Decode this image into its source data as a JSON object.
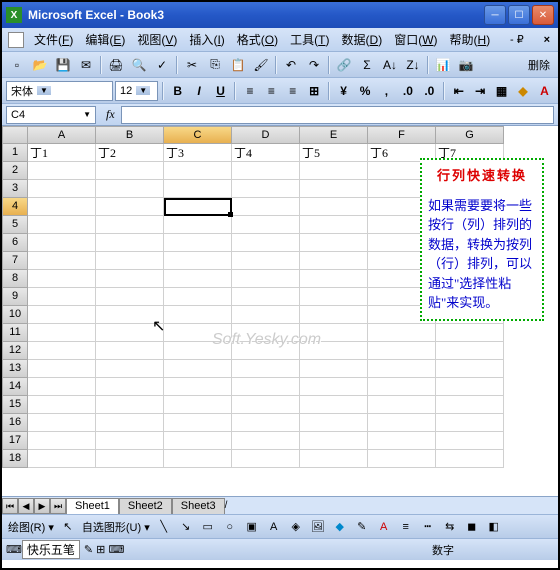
{
  "window": {
    "title": "Microsoft Excel - Book3",
    "app_icon": "X"
  },
  "menu": {
    "items": [
      {
        "label": "文件",
        "key": "F"
      },
      {
        "label": "编辑",
        "key": "E"
      },
      {
        "label": "视图",
        "key": "V"
      },
      {
        "label": "插入",
        "key": "I"
      },
      {
        "label": "格式",
        "key": "O"
      },
      {
        "label": "工具",
        "key": "T"
      },
      {
        "label": "数据",
        "key": "D"
      },
      {
        "label": "窗口",
        "key": "W"
      },
      {
        "label": "帮助",
        "key": "H"
      }
    ]
  },
  "toolbar": {
    "delete_label": "删除"
  },
  "format": {
    "font": "宋体",
    "size": "12"
  },
  "namebox": {
    "value": "C4"
  },
  "columns": [
    "A",
    "B",
    "C",
    "D",
    "E",
    "F",
    "G"
  ],
  "row_numbers": [
    1,
    2,
    3,
    4,
    5,
    6,
    7,
    8,
    9,
    10,
    11,
    12,
    13,
    14,
    15,
    16,
    17,
    18
  ],
  "cells": {
    "row1": [
      "丁1",
      "丁2",
      "丁3",
      "丁4",
      "丁5",
      "丁6",
      "丁7"
    ]
  },
  "selected": {
    "col": "C",
    "row": 4
  },
  "tooltip": {
    "title": "行列快速转换",
    "body": "如果需要要将一些按行（列）排列的数据，转换为按列（行）排列，可以通过\"选择性粘贴\"来实现。"
  },
  "watermark": "Soft.Yesky.com",
  "sheets": {
    "tabs": [
      "Sheet1",
      "Sheet2",
      "Sheet3"
    ],
    "active": 0
  },
  "drawbar": {
    "label1": "绘图(R)",
    "label2": "自选图形(U)"
  },
  "status": {
    "ime": "快乐五笔",
    "mode": "数字"
  }
}
